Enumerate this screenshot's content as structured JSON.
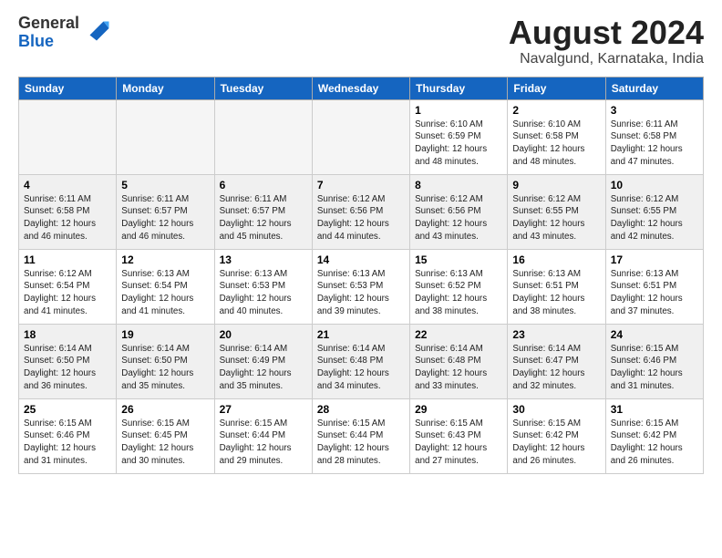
{
  "header": {
    "logo_general": "General",
    "logo_blue": "Blue",
    "month_year": "August 2024",
    "location": "Navalgund, Karnataka, India"
  },
  "days_of_week": [
    "Sunday",
    "Monday",
    "Tuesday",
    "Wednesday",
    "Thursday",
    "Friday",
    "Saturday"
  ],
  "weeks": [
    [
      {
        "day": null
      },
      {
        "day": null
      },
      {
        "day": null
      },
      {
        "day": null
      },
      {
        "day": 1,
        "sunrise": "6:10 AM",
        "sunset": "6:59 PM",
        "daylight": "12 hours and 48 minutes."
      },
      {
        "day": 2,
        "sunrise": "6:10 AM",
        "sunset": "6:58 PM",
        "daylight": "12 hours and 48 minutes."
      },
      {
        "day": 3,
        "sunrise": "6:11 AM",
        "sunset": "6:58 PM",
        "daylight": "12 hours and 47 minutes."
      }
    ],
    [
      {
        "day": 4,
        "sunrise": "6:11 AM",
        "sunset": "6:58 PM",
        "daylight": "12 hours and 46 minutes."
      },
      {
        "day": 5,
        "sunrise": "6:11 AM",
        "sunset": "6:57 PM",
        "daylight": "12 hours and 46 minutes."
      },
      {
        "day": 6,
        "sunrise": "6:11 AM",
        "sunset": "6:57 PM",
        "daylight": "12 hours and 45 minutes."
      },
      {
        "day": 7,
        "sunrise": "6:12 AM",
        "sunset": "6:56 PM",
        "daylight": "12 hours and 44 minutes."
      },
      {
        "day": 8,
        "sunrise": "6:12 AM",
        "sunset": "6:56 PM",
        "daylight": "12 hours and 43 minutes."
      },
      {
        "day": 9,
        "sunrise": "6:12 AM",
        "sunset": "6:55 PM",
        "daylight": "12 hours and 43 minutes."
      },
      {
        "day": 10,
        "sunrise": "6:12 AM",
        "sunset": "6:55 PM",
        "daylight": "12 hours and 42 minutes."
      }
    ],
    [
      {
        "day": 11,
        "sunrise": "6:12 AM",
        "sunset": "6:54 PM",
        "daylight": "12 hours and 41 minutes."
      },
      {
        "day": 12,
        "sunrise": "6:13 AM",
        "sunset": "6:54 PM",
        "daylight": "12 hours and 41 minutes."
      },
      {
        "day": 13,
        "sunrise": "6:13 AM",
        "sunset": "6:53 PM",
        "daylight": "12 hours and 40 minutes."
      },
      {
        "day": 14,
        "sunrise": "6:13 AM",
        "sunset": "6:53 PM",
        "daylight": "12 hours and 39 minutes."
      },
      {
        "day": 15,
        "sunrise": "6:13 AM",
        "sunset": "6:52 PM",
        "daylight": "12 hours and 38 minutes."
      },
      {
        "day": 16,
        "sunrise": "6:13 AM",
        "sunset": "6:51 PM",
        "daylight": "12 hours and 38 minutes."
      },
      {
        "day": 17,
        "sunrise": "6:13 AM",
        "sunset": "6:51 PM",
        "daylight": "12 hours and 37 minutes."
      }
    ],
    [
      {
        "day": 18,
        "sunrise": "6:14 AM",
        "sunset": "6:50 PM",
        "daylight": "12 hours and 36 minutes."
      },
      {
        "day": 19,
        "sunrise": "6:14 AM",
        "sunset": "6:50 PM",
        "daylight": "12 hours and 35 minutes."
      },
      {
        "day": 20,
        "sunrise": "6:14 AM",
        "sunset": "6:49 PM",
        "daylight": "12 hours and 35 minutes."
      },
      {
        "day": 21,
        "sunrise": "6:14 AM",
        "sunset": "6:48 PM",
        "daylight": "12 hours and 34 minutes."
      },
      {
        "day": 22,
        "sunrise": "6:14 AM",
        "sunset": "6:48 PM",
        "daylight": "12 hours and 33 minutes."
      },
      {
        "day": 23,
        "sunrise": "6:14 AM",
        "sunset": "6:47 PM",
        "daylight": "12 hours and 32 minutes."
      },
      {
        "day": 24,
        "sunrise": "6:15 AM",
        "sunset": "6:46 PM",
        "daylight": "12 hours and 31 minutes."
      }
    ],
    [
      {
        "day": 25,
        "sunrise": "6:15 AM",
        "sunset": "6:46 PM",
        "daylight": "12 hours and 31 minutes."
      },
      {
        "day": 26,
        "sunrise": "6:15 AM",
        "sunset": "6:45 PM",
        "daylight": "12 hours and 30 minutes."
      },
      {
        "day": 27,
        "sunrise": "6:15 AM",
        "sunset": "6:44 PM",
        "daylight": "12 hours and 29 minutes."
      },
      {
        "day": 28,
        "sunrise": "6:15 AM",
        "sunset": "6:44 PM",
        "daylight": "12 hours and 28 minutes."
      },
      {
        "day": 29,
        "sunrise": "6:15 AM",
        "sunset": "6:43 PM",
        "daylight": "12 hours and 27 minutes."
      },
      {
        "day": 30,
        "sunrise": "6:15 AM",
        "sunset": "6:42 PM",
        "daylight": "12 hours and 26 minutes."
      },
      {
        "day": 31,
        "sunrise": "6:15 AM",
        "sunset": "6:42 PM",
        "daylight": "12 hours and 26 minutes."
      }
    ]
  ]
}
